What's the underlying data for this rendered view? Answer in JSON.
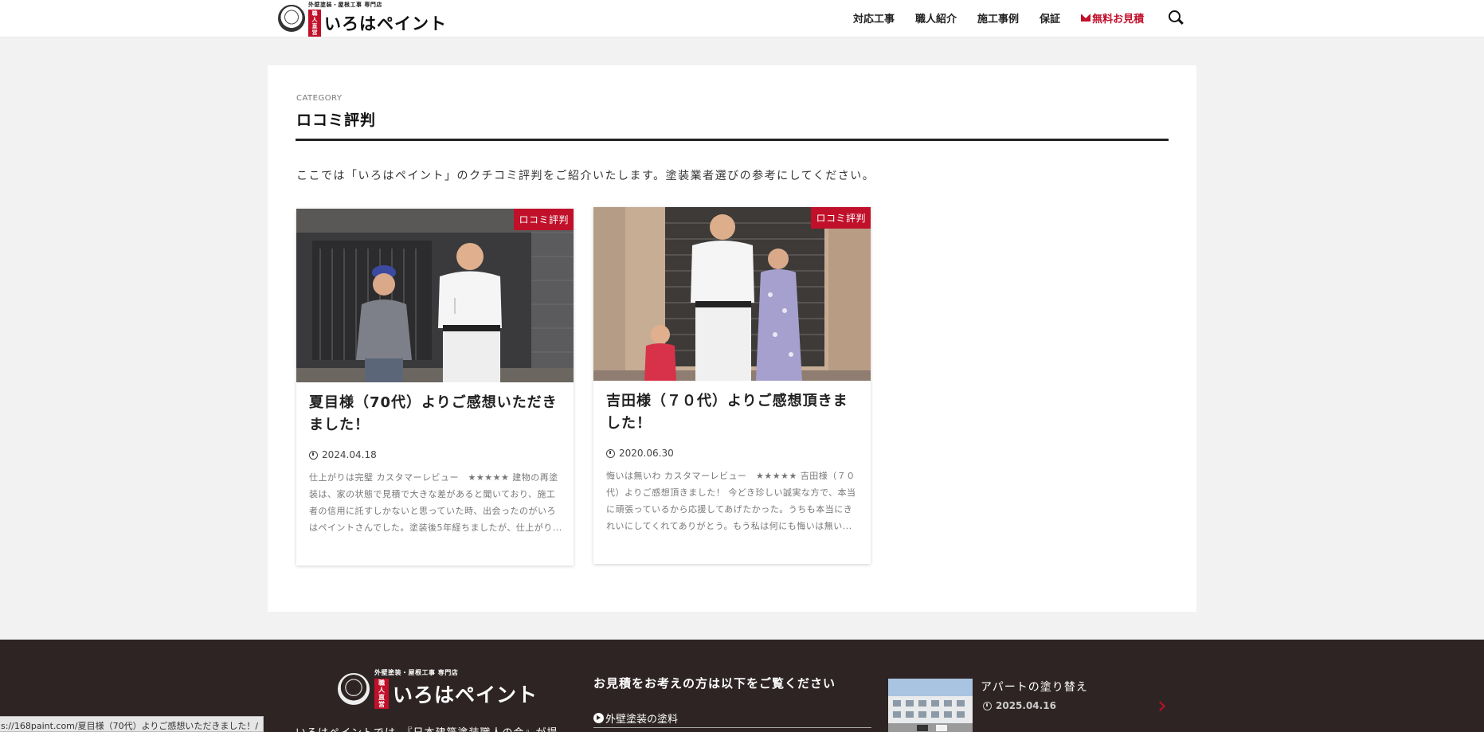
{
  "header": {
    "logo_tag": "外壁塗装・屋根工事 専門店",
    "logo_badge": "職人直営",
    "logo_name": "いろはペイント",
    "nav": [
      "対応工事",
      "職人紹介",
      "施工事例",
      "保証"
    ],
    "estimate_label": "無料お見積"
  },
  "category": {
    "label": "CATEGORY",
    "title": "ロコミ評判",
    "description": "ここでは「いろはペイント」のクチコミ評判をご紹介いたします。塗装業者選びの参考にしてください。"
  },
  "cards": [
    {
      "ribbon": "ロコミ評判",
      "title": "夏目様（70代）よりご感想いただきました！",
      "date": "2024.04.18",
      "excerpt": "仕上がりは完璧 カスタマーレビュー　★★★★★ 建物の再塗装は、家の状態で見積で大きな差があると聞いており、施工者の信用に託すしかないと思っていた時、出会ったのがいろはペイントさんでした。塗装後5年経ちましたが、仕上がり..."
    },
    {
      "ribbon": "ロコミ評判",
      "title": "吉田様（７０代）よりご感想頂きました！",
      "date": "2020.06.30",
      "excerpt": "悔いは無いわ カスタマーレビュー　★★★★★ 吉田様（７０代）よりご感想頂きました！ 今どき珍しい誠実な方で、本当に頑張っているから応援してあげたかった。うちも本当にきれいにしてくれてありがとう。もう私は何にも悔いは無い..."
    }
  ],
  "footer": {
    "logo_tag": "外壁塗装・屋根工事 専門店",
    "logo_badge": "職人直営",
    "logo_name": "いろはペイント",
    "text": "いろはペイントでは、『日本建築塗装職人の会』が提",
    "heading": "お見積をお考えの方は以下をご覧ください",
    "link": "外壁塗装の塗料",
    "post_title": "アパートの塗り替え",
    "post_date": "2025.04.16"
  },
  "status_url": "s://168paint.com/夏目様（70代）よりご感想いただきました！/",
  "colors": {
    "accent": "#c0102a",
    "footer_bg": "#2e2424"
  }
}
